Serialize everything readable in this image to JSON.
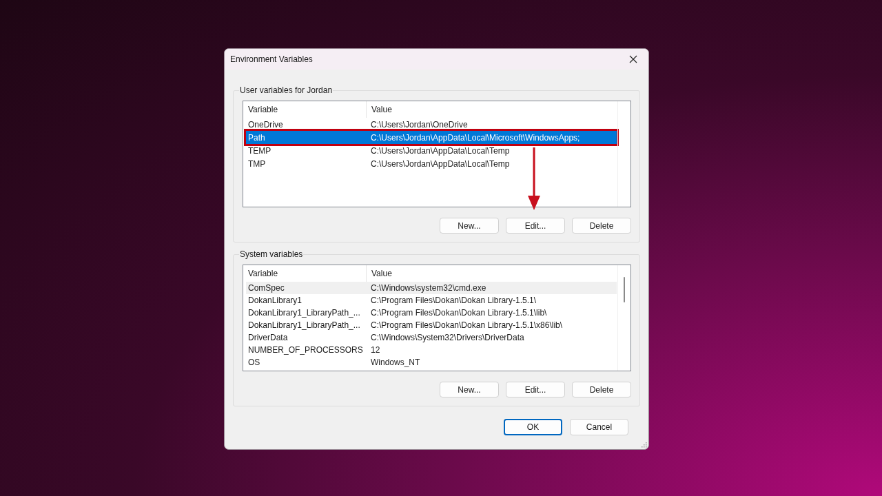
{
  "window": {
    "title": "Environment Variables"
  },
  "user_variables": {
    "label": "User variables for Jordan",
    "columns": [
      "Variable",
      "Value"
    ],
    "rows": [
      {
        "variable": "OneDrive",
        "value": "C:\\Users\\Jordan\\OneDrive",
        "selected": false,
        "outlined": false
      },
      {
        "variable": "Path",
        "value": "C:\\Users\\Jordan\\AppData\\Local\\Microsoft\\WindowsApps;",
        "selected": true,
        "outlined": true
      },
      {
        "variable": "TEMP",
        "value": "C:\\Users\\Jordan\\AppData\\Local\\Temp",
        "selected": false,
        "outlined": false
      },
      {
        "variable": "TMP",
        "value": "C:\\Users\\Jordan\\AppData\\Local\\Temp",
        "selected": false,
        "outlined": false
      }
    ],
    "buttons": [
      "New...",
      "Edit...",
      "Delete"
    ]
  },
  "system_variables": {
    "label": "System variables",
    "columns": [
      "Variable",
      "Value"
    ],
    "rows": [
      {
        "variable": "ComSpec",
        "value": "C:\\Windows\\system32\\cmd.exe",
        "hovered": true
      },
      {
        "variable": "DokanLibrary1",
        "value": "C:\\Program Files\\Dokan\\Dokan Library-1.5.1\\",
        "hovered": false
      },
      {
        "variable": "DokanLibrary1_LibraryPath_...",
        "value": "C:\\Program Files\\Dokan\\Dokan Library-1.5.1\\lib\\",
        "hovered": false
      },
      {
        "variable": "DokanLibrary1_LibraryPath_...",
        "value": "C:\\Program Files\\Dokan\\Dokan Library-1.5.1\\x86\\lib\\",
        "hovered": false
      },
      {
        "variable": "DriverData",
        "value": "C:\\Windows\\System32\\Drivers\\DriverData",
        "hovered": false
      },
      {
        "variable": "NUMBER_OF_PROCESSORS",
        "value": "12",
        "hovered": false
      },
      {
        "variable": "OS",
        "value": "Windows_NT",
        "hovered": false
      }
    ],
    "buttons": [
      "New...",
      "Edit...",
      "Delete"
    ]
  },
  "buttons": [
    {
      "label": "OK",
      "default": true
    },
    {
      "label": "Cancel",
      "default": false
    }
  ]
}
